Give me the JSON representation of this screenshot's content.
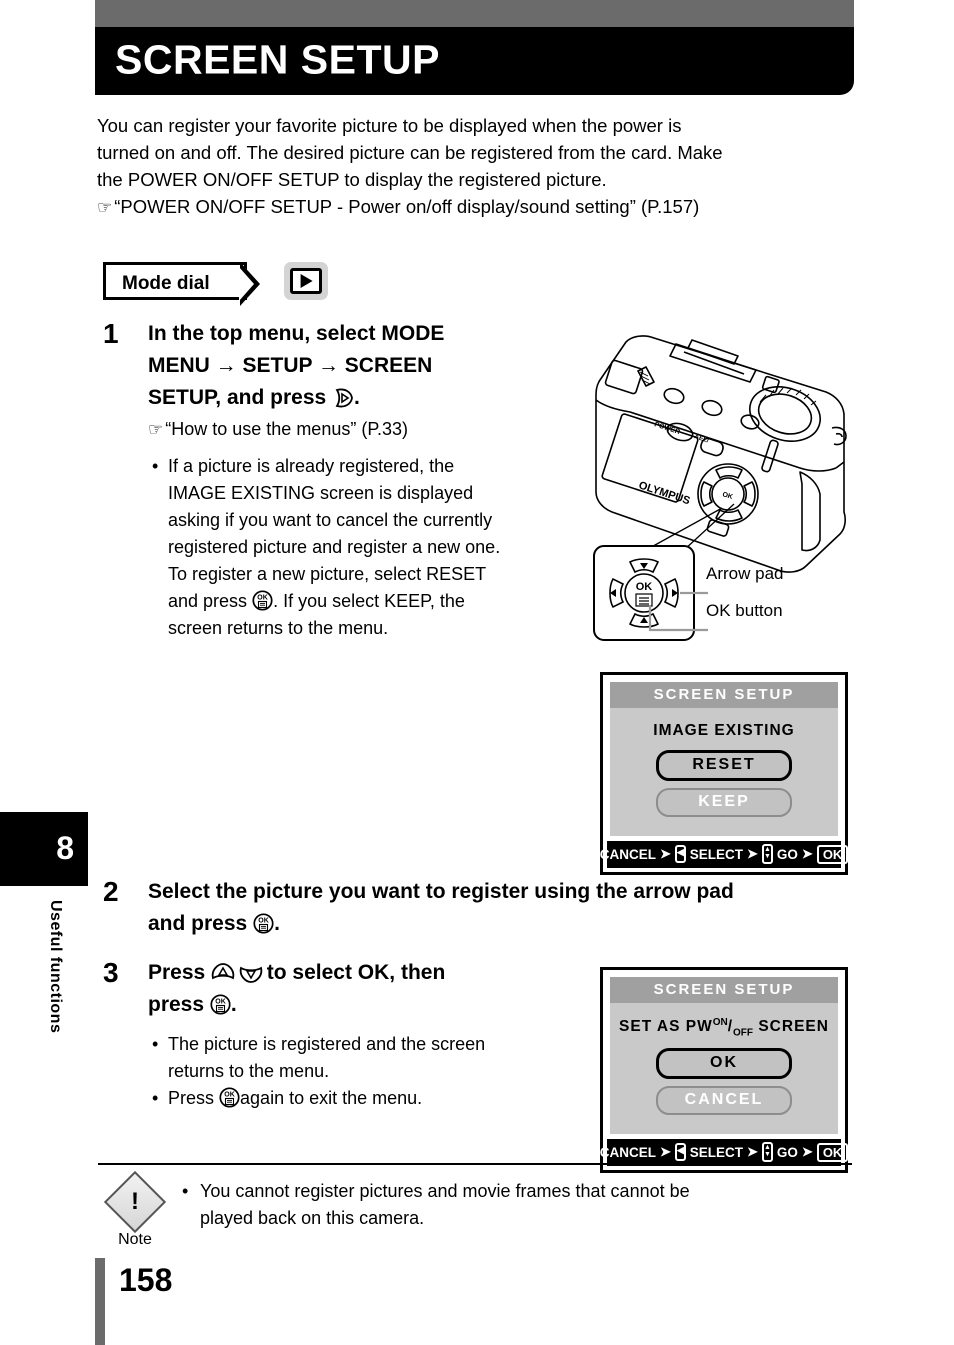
{
  "header": {
    "title": "SCREEN SETUP"
  },
  "intro": {
    "line1": "You can register your favorite picture to be displayed when the power is",
    "line2": "turned on and off. The desired picture can be registered from the card. Make",
    "line3": "the POWER ON/OFF SETUP to display the registered picture.",
    "reference": "“POWER ON/OFF SETUP - Power on/off display/sound setting” (P.157)"
  },
  "mode_dial": {
    "label": "Mode dial",
    "icon": "playback-icon"
  },
  "steps": [
    {
      "number": "1",
      "heading_a": "In the top menu, select MODE",
      "heading_b": "MENU → SETUP → SCREEN",
      "heading_c": "SETUP, and press",
      "heading_end": ".",
      "reference": "“How to use the menus” (P.33)",
      "bullets_line1": "If a picture is already registered, the",
      "bullets_line2": "IMAGE EXISTING screen is displayed",
      "bullets_line3": "asking if you want to cancel the currently",
      "bullets_line4": "registered picture and register a new one.",
      "bullets_line5": "To register a new picture, select RESET",
      "bullets_line6a": "and press",
      "bullets_line6b": ". If you select KEEP, the",
      "bullets_line7": "screen returns to the menu."
    },
    {
      "number": "2",
      "heading_a": "Select the picture you want to register using the arrow pad",
      "heading_b": "and press",
      "heading_end": "."
    },
    {
      "number": "3",
      "heading_a": "Press",
      "heading_b": "to select OK, then",
      "heading_c": "press",
      "heading_end": ".",
      "bullet1a": "The picture is registered and the screen",
      "bullet1b": "returns to the menu.",
      "bullet2a": "Press",
      "bullet2b": "again to exit the menu."
    }
  ],
  "camera_figure": {
    "brand": "OLYMPUS",
    "power_label": "POWER",
    "ael_label": "AEL/",
    "ok_label": "OK",
    "callout_arrow_pad": "Arrow pad",
    "callout_ok_button": "OK button"
  },
  "lcd_screens": [
    {
      "name": "image-existing-screen",
      "title": "SCREEN SETUP",
      "message": "IMAGE  EXISTING",
      "option_selected": "RESET",
      "option_unselected": "KEEP",
      "bar": {
        "cancel": "CANCEL",
        "select": "SELECT",
        "go": "GO",
        "ok": "OK"
      }
    },
    {
      "name": "set-as-power-screen",
      "title": "SCREEN SETUP",
      "message_pre": "SET  AS  PW",
      "message_sup": "ON",
      "message_slash": "/",
      "message_sub": "OFF",
      "message_post": "SCREEN",
      "option_selected": "OK",
      "option_unselected": "CANCEL",
      "bar": {
        "cancel": "CANCEL",
        "select": "SELECT",
        "go": "GO",
        "ok": "OK"
      }
    }
  ],
  "note": {
    "caption": "Note",
    "text_line1": "You cannot register pictures and movie frames that cannot be",
    "text_line2": "played back on this camera."
  },
  "chapter": {
    "number": "8",
    "label": "Useful functions"
  },
  "footer": {
    "page_number": "158"
  },
  "colors": {
    "gray_bar": "#6b6b6b",
    "title_bar": "#000000",
    "lcd_body": "#c9c9c9",
    "lcd_header": "#a0a0a0"
  }
}
